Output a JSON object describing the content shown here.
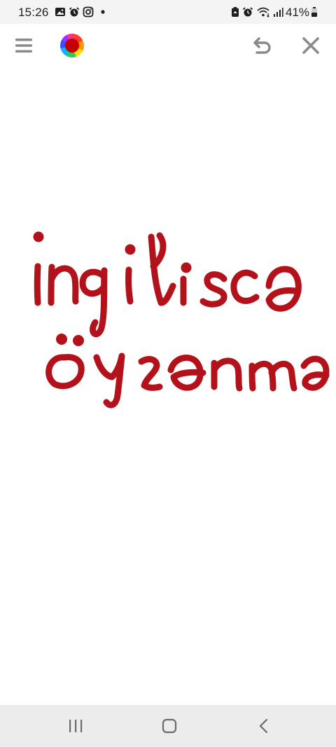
{
  "status_bar": {
    "time": "15:26",
    "left_icons": [
      "gallery-icon",
      "alarm-icon",
      "instagram-icon",
      "notification-dot-icon"
    ],
    "right_icons": [
      "battery-saver-icon",
      "alarm-icon",
      "wifi-icon",
      "signal-icon",
      "battery-icon"
    ],
    "battery_percent": "41%"
  },
  "toolbar": {
    "menu_icon": "menu-icon",
    "color_picker_icon": "color-wheel-icon",
    "selected_color": "#c40000",
    "undo_icon": "undo-icon",
    "close_icon": "close-icon",
    "icon_color": "#8a8a8a"
  },
  "canvas": {
    "background": "#ffffff",
    "ink_color": "#b3121b",
    "handwriting": [
      "ingilisca",
      "öyrənmə"
    ]
  },
  "nav_bar": {
    "recent_apps_icon": "recent-apps-icon",
    "home_icon": "home-icon",
    "back_icon": "back-icon"
  }
}
